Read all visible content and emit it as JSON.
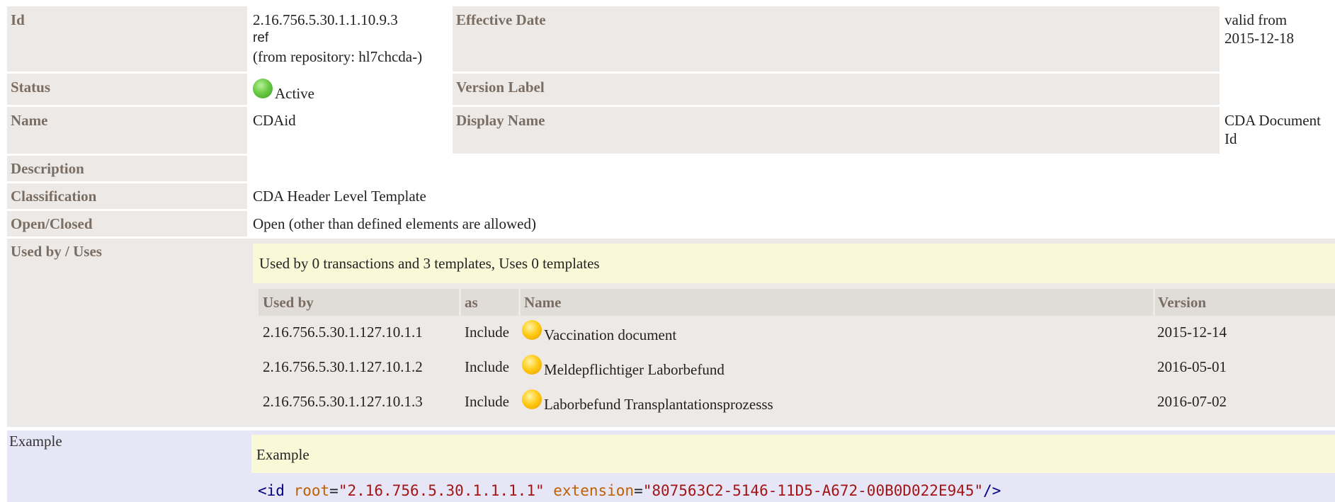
{
  "id": {
    "label": "Id",
    "value_line1": "2.16.756.5.30.1.1.10.9.3",
    "value_line2": "ref",
    "value_line3": "(from repository: hl7chcda-)"
  },
  "effective_date": {
    "label": "Effective Date",
    "value_line1": "valid from",
    "value_line2": "2015-12-18"
  },
  "status": {
    "label": "Status",
    "value": "Active",
    "color": "#5cbf3a"
  },
  "version_label": {
    "label": "Version Label",
    "value": ""
  },
  "name": {
    "label": "Name",
    "value": "CDAid"
  },
  "display_name": {
    "label": "Display Name",
    "value_line1": "CDA Document",
    "value_line2": "Id"
  },
  "description": {
    "label": "Description",
    "value": ""
  },
  "classification": {
    "label": "Classification",
    "value": "CDA Header Level Template"
  },
  "open_closed": {
    "label": "Open/Closed",
    "value": "Open (other than defined elements are allowed)"
  },
  "used_by": {
    "label": "Used by / Uses",
    "summary": "Used by 0 transactions and 3 templates, Uses 0 templates",
    "columns": {
      "used_by": "Used by",
      "as": "as",
      "name": "Name",
      "version": "Version"
    },
    "rows": [
      {
        "id": "2.16.756.5.30.1.127.10.1.1",
        "as": "Include",
        "name": "Vaccination document",
        "version": "2015-12-14"
      },
      {
        "id": "2.16.756.5.30.1.127.10.1.2",
        "as": "Include",
        "name": "Meldepflichtiger Laborbefund",
        "version": "2016-05-01"
      },
      {
        "id": "2.16.756.5.30.1.127.10.1.3",
        "as": "Include",
        "name": "Laborbefund Transplantationsprozesss",
        "version": "2016-07-02"
      }
    ],
    "status_icon": "pending-status-icon"
  },
  "example": {
    "label": "Example",
    "title": "Example",
    "code": {
      "open": "<id ",
      "attr1": "root",
      "eq1": "=",
      "val1": "\"2.16.756.5.30.1.1.1.1\"",
      "attr2": "extension",
      "eq2": "=",
      "val2": "\"807563C2-5146-11D5-A672-00B0D022E945\"",
      "close": "/>"
    }
  },
  "colors": {
    "label_bg": "#ece9e6",
    "label_text": "#7a6d63",
    "example_bg": "#e6e6f7",
    "summary_bg": "#f9f9d8",
    "active_dot": "#5cbf3a",
    "pending_dot": "#ffc80f"
  }
}
